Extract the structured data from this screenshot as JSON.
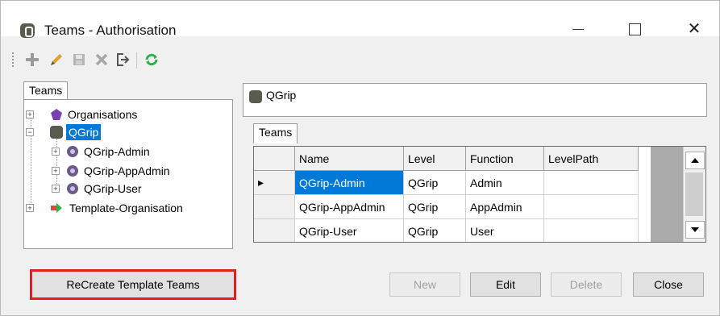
{
  "window": {
    "title": "Teams - Authorisation"
  },
  "toolbar": {
    "items": [
      "add-icon",
      "edit-icon",
      "save-icon",
      "delete-icon",
      "exit-icon",
      "refresh-icon"
    ]
  },
  "left_panel": {
    "tab": "Teams",
    "tree": [
      {
        "label": "Organisations",
        "icon": "organisations-icon",
        "expand": "+"
      },
      {
        "label": "QGrip",
        "icon": "qgrip-icon",
        "expand": "−",
        "selected": true
      },
      {
        "label": "QGrip-Admin",
        "icon": "team-icon",
        "expand": "+"
      },
      {
        "label": "QGrip-AppAdmin",
        "icon": "team-icon",
        "expand": "+"
      },
      {
        "label": "QGrip-User",
        "icon": "team-icon",
        "expand": "+"
      },
      {
        "label": "Template-Organisation",
        "icon": "template-icon",
        "expand": "+"
      }
    ]
  },
  "right_panel": {
    "path": "QGrip",
    "tab": "Teams",
    "columns": [
      "Name",
      "Level",
      "Function",
      "LevelPath"
    ],
    "rows": [
      [
        "QGrip-Admin",
        "QGrip",
        "Admin",
        ""
      ],
      [
        "QGrip-AppAdmin",
        "QGrip",
        "AppAdmin",
        ""
      ],
      [
        "QGrip-User",
        "QGrip",
        "User",
        ""
      ]
    ],
    "current_row_marker": "▸"
  },
  "buttons": {
    "recreate": "ReCreate Template Teams",
    "new": "New",
    "edit": "Edit",
    "delete": "Delete",
    "close": "Close"
  },
  "colors": {
    "selection": "#0078d7",
    "highlight_border": "#e02020",
    "accent_green": "#2bb34a"
  }
}
